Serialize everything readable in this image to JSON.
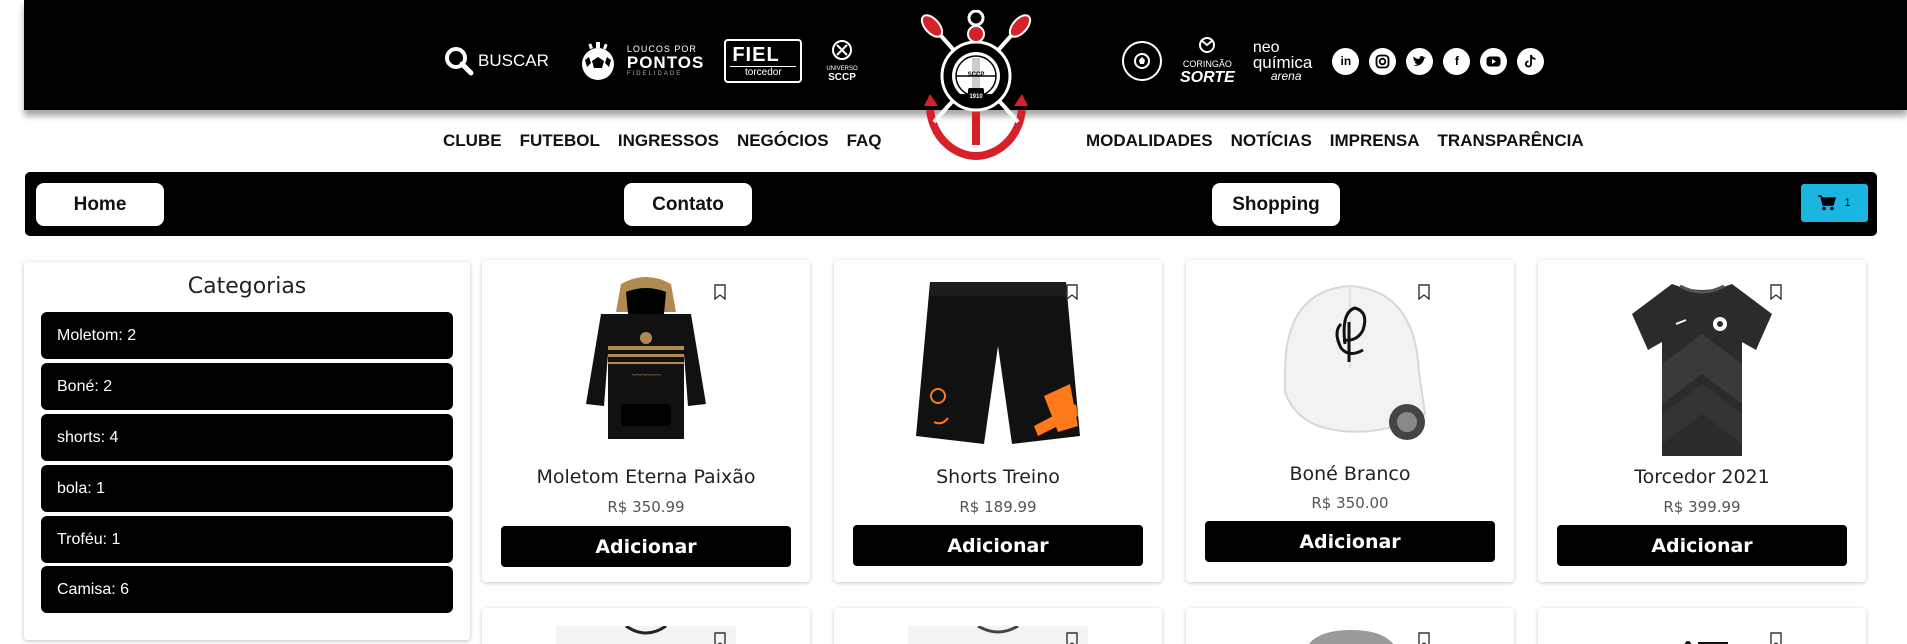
{
  "header": {
    "search_label": "BUSCAR",
    "loucos_line1": "LOUCOS POR",
    "loucos_line2": "PONTOS",
    "loucos_line3": "FIDELIDADE",
    "fiel_line1": "FIEL",
    "fiel_line2": "torcedor",
    "sccp_line1": "UNIVERSO",
    "sccp_line2": "SCCP",
    "crest_year": "1910",
    "crest_ring": "CORINTHIANS PAULISTA",
    "crest_letters": "SCCP",
    "peneira_label": "CHUTE INICIAL CORINTHIANS",
    "coring_line1": "CORINGÃO",
    "coring_line2": "SORTE",
    "neo_line1": "neo",
    "neo_line2": "química",
    "neo_line3": "arena",
    "social": [
      "in",
      "ig",
      "tw",
      "f",
      "yt",
      "tk"
    ],
    "brand_color": "#000000",
    "crest_red": "#d6202a"
  },
  "nav_left": [
    "CLUBE",
    "FUTEBOL",
    "INGRESSOS",
    "NEGÓCIOS",
    "FAQ"
  ],
  "nav_right": [
    "MODALIDADES",
    "NOTÍCIAS",
    "IMPRENSA",
    "TRANSPARÊNCIA"
  ],
  "subnav": {
    "home": "Home",
    "contato": "Contato",
    "shopping": "Shopping",
    "cart_count": "1",
    "cart_color": "#1ab5e0"
  },
  "sidebar": {
    "title": "Categorias",
    "items": [
      "Moletom: 2",
      "Boné: 2",
      "shorts: 4",
      "bola: 1",
      "Troféu: 1",
      "Camisa: 6"
    ]
  },
  "products": [
    {
      "name": "Moletom Eterna Paixão",
      "price": "R$ 350.99",
      "button": "Adicionar",
      "image": "hoodie"
    },
    {
      "name": "Shorts Treino",
      "price": "R$ 189.99",
      "button": "Adicionar",
      "image": "shorts"
    },
    {
      "name": "Boné Branco",
      "price": "R$ 350.00",
      "button": "Adicionar",
      "image": "cap"
    },
    {
      "name": "Torcedor 2021",
      "price": "R$ 399.99",
      "button": "Adicionar",
      "image": "jersey"
    }
  ]
}
